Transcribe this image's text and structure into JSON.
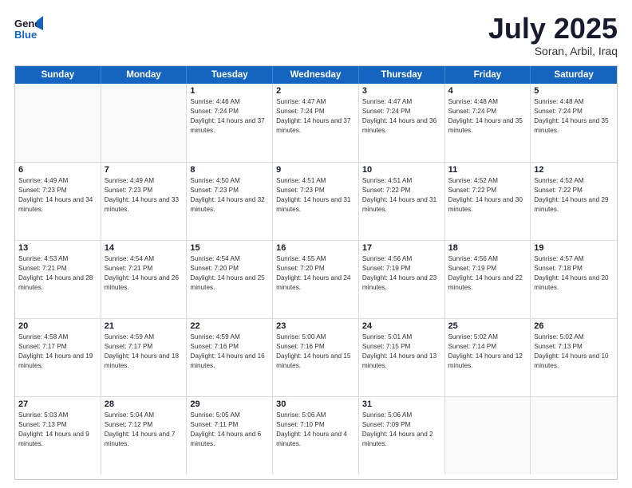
{
  "header": {
    "logo_line1": "General",
    "logo_line2": "Blue",
    "month": "July 2025",
    "location": "Soran, Arbil, Iraq"
  },
  "days_of_week": [
    "Sunday",
    "Monday",
    "Tuesday",
    "Wednesday",
    "Thursday",
    "Friday",
    "Saturday"
  ],
  "weeks": [
    [
      {
        "day": "",
        "empty": true
      },
      {
        "day": "",
        "empty": true
      },
      {
        "day": "1",
        "sunrise": "4:46 AM",
        "sunset": "7:24 PM",
        "daylight": "14 hours and 37 minutes."
      },
      {
        "day": "2",
        "sunrise": "4:47 AM",
        "sunset": "7:24 PM",
        "daylight": "14 hours and 37 minutes."
      },
      {
        "day": "3",
        "sunrise": "4:47 AM",
        "sunset": "7:24 PM",
        "daylight": "14 hours and 36 minutes."
      },
      {
        "day": "4",
        "sunrise": "4:48 AM",
        "sunset": "7:24 PM",
        "daylight": "14 hours and 35 minutes."
      },
      {
        "day": "5",
        "sunrise": "4:48 AM",
        "sunset": "7:24 PM",
        "daylight": "14 hours and 35 minutes."
      }
    ],
    [
      {
        "day": "6",
        "sunrise": "4:49 AM",
        "sunset": "7:23 PM",
        "daylight": "14 hours and 34 minutes."
      },
      {
        "day": "7",
        "sunrise": "4:49 AM",
        "sunset": "7:23 PM",
        "daylight": "14 hours and 33 minutes."
      },
      {
        "day": "8",
        "sunrise": "4:50 AM",
        "sunset": "7:23 PM",
        "daylight": "14 hours and 32 minutes."
      },
      {
        "day": "9",
        "sunrise": "4:51 AM",
        "sunset": "7:23 PM",
        "daylight": "14 hours and 31 minutes."
      },
      {
        "day": "10",
        "sunrise": "4:51 AM",
        "sunset": "7:22 PM",
        "daylight": "14 hours and 31 minutes."
      },
      {
        "day": "11",
        "sunrise": "4:52 AM",
        "sunset": "7:22 PM",
        "daylight": "14 hours and 30 minutes."
      },
      {
        "day": "12",
        "sunrise": "4:52 AM",
        "sunset": "7:22 PM",
        "daylight": "14 hours and 29 minutes."
      }
    ],
    [
      {
        "day": "13",
        "sunrise": "4:53 AM",
        "sunset": "7:21 PM",
        "daylight": "14 hours and 28 minutes."
      },
      {
        "day": "14",
        "sunrise": "4:54 AM",
        "sunset": "7:21 PM",
        "daylight": "14 hours and 26 minutes."
      },
      {
        "day": "15",
        "sunrise": "4:54 AM",
        "sunset": "7:20 PM",
        "daylight": "14 hours and 25 minutes."
      },
      {
        "day": "16",
        "sunrise": "4:55 AM",
        "sunset": "7:20 PM",
        "daylight": "14 hours and 24 minutes."
      },
      {
        "day": "17",
        "sunrise": "4:56 AM",
        "sunset": "7:19 PM",
        "daylight": "14 hours and 23 minutes."
      },
      {
        "day": "18",
        "sunrise": "4:56 AM",
        "sunset": "7:19 PM",
        "daylight": "14 hours and 22 minutes."
      },
      {
        "day": "19",
        "sunrise": "4:57 AM",
        "sunset": "7:18 PM",
        "daylight": "14 hours and 20 minutes."
      }
    ],
    [
      {
        "day": "20",
        "sunrise": "4:58 AM",
        "sunset": "7:17 PM",
        "daylight": "14 hours and 19 minutes."
      },
      {
        "day": "21",
        "sunrise": "4:59 AM",
        "sunset": "7:17 PM",
        "daylight": "14 hours and 18 minutes."
      },
      {
        "day": "22",
        "sunrise": "4:59 AM",
        "sunset": "7:16 PM",
        "daylight": "14 hours and 16 minutes."
      },
      {
        "day": "23",
        "sunrise": "5:00 AM",
        "sunset": "7:16 PM",
        "daylight": "14 hours and 15 minutes."
      },
      {
        "day": "24",
        "sunrise": "5:01 AM",
        "sunset": "7:15 PM",
        "daylight": "14 hours and 13 minutes."
      },
      {
        "day": "25",
        "sunrise": "5:02 AM",
        "sunset": "7:14 PM",
        "daylight": "14 hours and 12 minutes."
      },
      {
        "day": "26",
        "sunrise": "5:02 AM",
        "sunset": "7:13 PM",
        "daylight": "14 hours and 10 minutes."
      }
    ],
    [
      {
        "day": "27",
        "sunrise": "5:03 AM",
        "sunset": "7:13 PM",
        "daylight": "14 hours and 9 minutes."
      },
      {
        "day": "28",
        "sunrise": "5:04 AM",
        "sunset": "7:12 PM",
        "daylight": "14 hours and 7 minutes."
      },
      {
        "day": "29",
        "sunrise": "5:05 AM",
        "sunset": "7:11 PM",
        "daylight": "14 hours and 6 minutes."
      },
      {
        "day": "30",
        "sunrise": "5:06 AM",
        "sunset": "7:10 PM",
        "daylight": "14 hours and 4 minutes."
      },
      {
        "day": "31",
        "sunrise": "5:06 AM",
        "sunset": "7:09 PM",
        "daylight": "14 hours and 2 minutes."
      },
      {
        "day": "",
        "empty": true
      },
      {
        "day": "",
        "empty": true
      }
    ]
  ]
}
